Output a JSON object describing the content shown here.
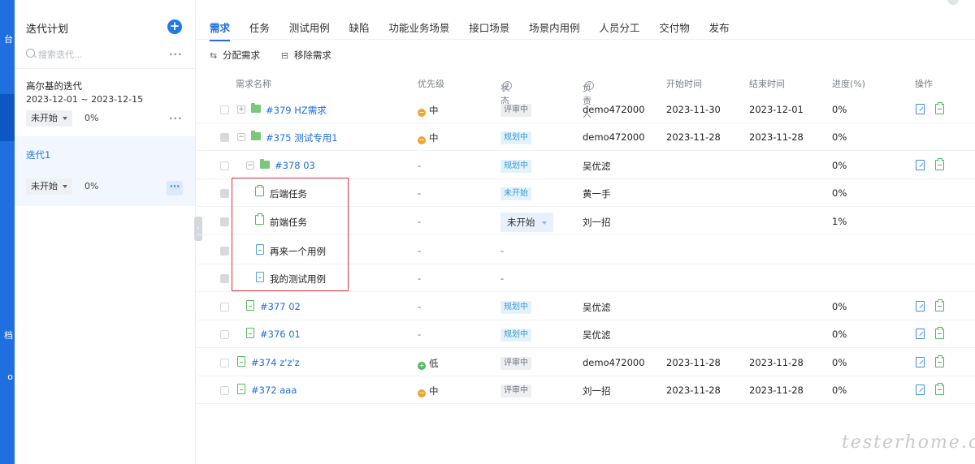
{
  "nav": {
    "labels": [
      "台",
      "档",
      "o"
    ]
  },
  "iteration_panel": {
    "title": "迭代计划",
    "search_placeholder": "搜索迭代...",
    "more": "···",
    "items": [
      {
        "name": "高尔基的迭代",
        "dates": "2023-12-01 ~ 2023-12-15",
        "status": "未开始",
        "progress": "0%",
        "more": "···"
      },
      {
        "name": "迭代1",
        "dates": "",
        "status": "未开始",
        "progress": "0%",
        "more": "···"
      }
    ]
  },
  "tabs": [
    "需求",
    "任务",
    "测试用例",
    "缺陷",
    "功能业务场景",
    "接口场景",
    "场景内用例",
    "人员分工",
    "交付物",
    "发布"
  ],
  "toolbar": {
    "assign": "分配需求",
    "remove": "移除需求"
  },
  "columns": {
    "name": "需求名称",
    "priority": "优先级",
    "status": "状态",
    "owner": "负责人",
    "start": "开始时间",
    "end": "结束时间",
    "progress": "进度(%)",
    "action": "操作"
  },
  "rows": [
    {
      "name": "#379 HZ需求",
      "priority": "中",
      "status": "评审中",
      "owner": "demo472000",
      "start": "2023-11-30",
      "end": "2023-12-01",
      "progress": "0%"
    },
    {
      "name": "#375 测试专用1",
      "priority": "中",
      "status": "规划中",
      "owner": "demo472000",
      "start": "2023-11-28",
      "end": "2023-11-28",
      "progress": "0%"
    },
    {
      "name": "#378 03",
      "priority": "-",
      "status": "规划中",
      "owner": "吴优滤",
      "start": "",
      "end": "",
      "progress": "0%"
    },
    {
      "name": "后端任务",
      "priority": "-",
      "status": "未开始",
      "owner": "黄一手",
      "start": "",
      "end": "",
      "progress": "0%"
    },
    {
      "name": "前端任务",
      "priority": "-",
      "status": "未开始",
      "owner": "刘一招",
      "start": "",
      "end": "",
      "progress": "1%"
    },
    {
      "name": "再来一个用例",
      "priority": "-",
      "status": "-",
      "owner": "",
      "start": "",
      "end": "",
      "progress": ""
    },
    {
      "name": "我的测试用例",
      "priority": "-",
      "status": "-",
      "owner": "",
      "start": "",
      "end": "",
      "progress": ""
    },
    {
      "name": "#377 02",
      "priority": "-",
      "status": "规划中",
      "owner": "吴优滤",
      "start": "",
      "end": "",
      "progress": "0%"
    },
    {
      "name": "#376 01",
      "priority": "-",
      "status": "规划中",
      "owner": "吴优滤",
      "start": "",
      "end": "",
      "progress": "0%"
    },
    {
      "name": "#374 z'z'z",
      "priority": "低",
      "status": "评审中",
      "owner": "demo472000",
      "start": "2023-11-28",
      "end": "2023-11-28",
      "progress": "0%"
    },
    {
      "name": "#372 aaa",
      "priority": "中",
      "status": "评审中",
      "owner": "刘一招",
      "start": "2023-11-28",
      "end": "2023-11-28",
      "progress": "0%"
    }
  ],
  "watermark": "testerhome.com",
  "colors": {
    "accent": "#1f6fe0",
    "highlight": "#d9363e",
    "green": "#4fb85b",
    "orange": "#f0a430"
  }
}
